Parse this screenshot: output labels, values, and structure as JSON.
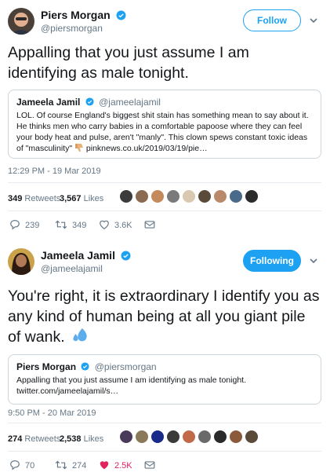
{
  "tweet1": {
    "author_name": "Piers Morgan",
    "author_handle": "@piersmorgan",
    "follow_label": "Follow",
    "text": "Appalling that you just assume I am identifying as male tonight.",
    "quote": {
      "name": "Jameela Jamil",
      "handle": "@jameelajamil",
      "text": "LOL. Of course England's biggest shit stain has something mean to say about it. He thinks men who carry babies in a comfortable papoose where they can feel your body heat and pulse, aren't \"manly\". This clown spews constant toxic ideas of \"masculinity\"",
      "link": "pinknews.co.uk/2019/03/19/pie…"
    },
    "timestamp": "12:29 PM - 19 Mar 2019",
    "retweets_count": "349",
    "retweets_label": "Retweets",
    "likes_count": "3,567",
    "likes_label": "Likes",
    "replies": "239",
    "retweets": "349",
    "likes": "3.6K",
    "liker_colors": [
      "#3b3b3b",
      "#8a6a50",
      "#c48a5c",
      "#7a7a7a",
      "#d8c9b0",
      "#5a4a3a",
      "#b88a6a",
      "#4a6a8a",
      "#2b2b2b"
    ]
  },
  "tweet2": {
    "author_name": "Jameela Jamil",
    "author_handle": "@jameelajamil",
    "follow_label": "Following",
    "text": "You're right, it is extraordinary I identify you as any kind of human being at all you giant pile of wank.",
    "quote": {
      "name": "Piers Morgan",
      "handle": "@piersmorgan",
      "text": "Appalling that you just assume I am identifying as male tonight.",
      "link": "twitter.com/jameelajamil/s…"
    },
    "timestamp": "9:50 PM - 20 Mar 2019",
    "retweets_count": "274",
    "retweets_label": "Retweets",
    "likes_count": "2,538",
    "likes_label": "Likes",
    "replies": "70",
    "retweets": "274",
    "likes": "2.5K",
    "liker_colors": [
      "#4a3a5a",
      "#8a7a5a",
      "#1a2a8a",
      "#3a3a3a",
      "#c06a4a",
      "#6a6a6a",
      "#2a2a2a",
      "#8a5a3a",
      "#5a4a3a"
    ]
  },
  "colors": {
    "accent": "#1da1f2",
    "muted": "#657786",
    "like_red": "#e0245e",
    "border": "#ccd6dd"
  }
}
